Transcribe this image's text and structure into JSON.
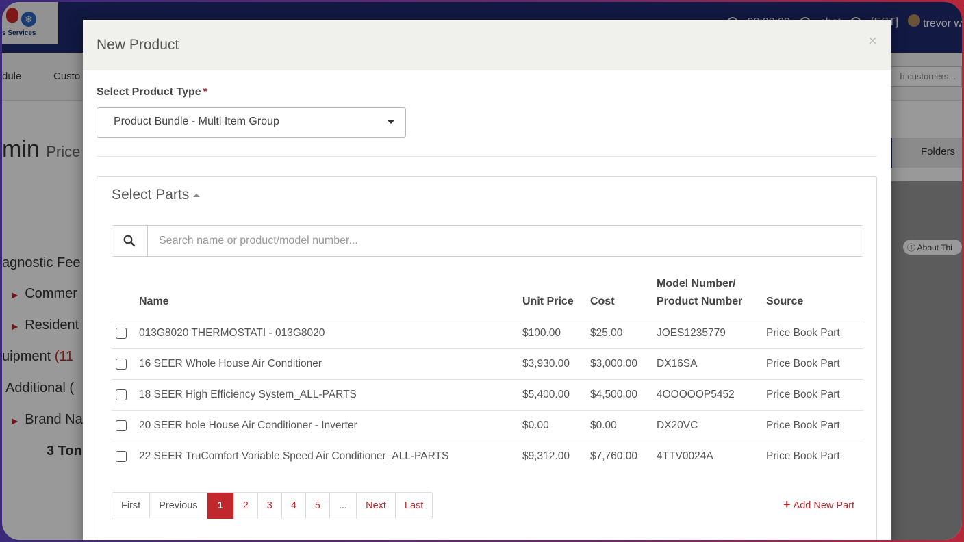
{
  "app": {
    "logo_text": "s Services",
    "top_right": {
      "time": "00:00:00",
      "chat": "chat",
      "est": "[EST]",
      "user": "trevor w"
    },
    "nav": {
      "item1": "dule",
      "item2": "Custo",
      "search_placeholder": "h customers..."
    },
    "page_title": "min",
    "page_subtitle": "Price",
    "folders_label": "Folders",
    "about_label": "ⓘ About Thi",
    "tree": {
      "diagnostic": "agnostic Fee",
      "commercial": "Commer",
      "residential": "Resident",
      "equipment": "uipment",
      "equipment_count": "(11",
      "additional": "Additional (",
      "brand": "Brand Na",
      "tons": "3 Ton"
    }
  },
  "modal": {
    "title": "New Product",
    "close_glyph": "×",
    "product_type_label": "Select Product Type",
    "required_mark": "*",
    "product_type_value": "Product Bundle - Multi Item Group",
    "parts_title": "Select Parts",
    "search_placeholder": "Search name or product/model number...",
    "columns": {
      "name": "Name",
      "unit_price": "Unit Price",
      "cost": "Cost",
      "model_line1": "Model Number/",
      "model_line2": "Product Number",
      "source": "Source"
    },
    "rows": [
      {
        "name": "013G8020 THERMOSTATI - 013G8020",
        "unit_price": "$100.00",
        "cost": "$25.00",
        "model": "JOES1235779",
        "source": "Price Book Part"
      },
      {
        "name": "16 SEER Whole House Air Conditioner",
        "unit_price": "$3,930.00",
        "cost": "$3,000.00",
        "model": "DX16SA",
        "source": "Price Book Part"
      },
      {
        "name": "18 SEER High Efficiency System_ALL-PARTS",
        "unit_price": "$5,400.00",
        "cost": "$4,500.00",
        "model": "4OOOOOP5452",
        "source": "Price Book Part"
      },
      {
        "name": "20 SEER hole House Air Conditioner - Inverter",
        "unit_price": "$0.00",
        "cost": "$0.00",
        "model": "DX20VC",
        "source": "Price Book Part"
      },
      {
        "name": "22 SEER TruComfort Variable Speed Air Conditioner_ALL-PARTS",
        "unit_price": "$9,312.00",
        "cost": "$7,760.00",
        "model": "4TTV0024A",
        "source": "Price Book Part"
      }
    ],
    "pagination": {
      "first": "First",
      "previous": "Previous",
      "pages": [
        "1",
        "2",
        "3",
        "4",
        "5"
      ],
      "ellipsis": "...",
      "next": "Next",
      "last": "Last",
      "current": "1"
    },
    "add_new_part": "Add New Part",
    "add_glyph": "+"
  },
  "colors": {
    "accent": "#c0282e",
    "topbar": "#1f2b6e"
  }
}
